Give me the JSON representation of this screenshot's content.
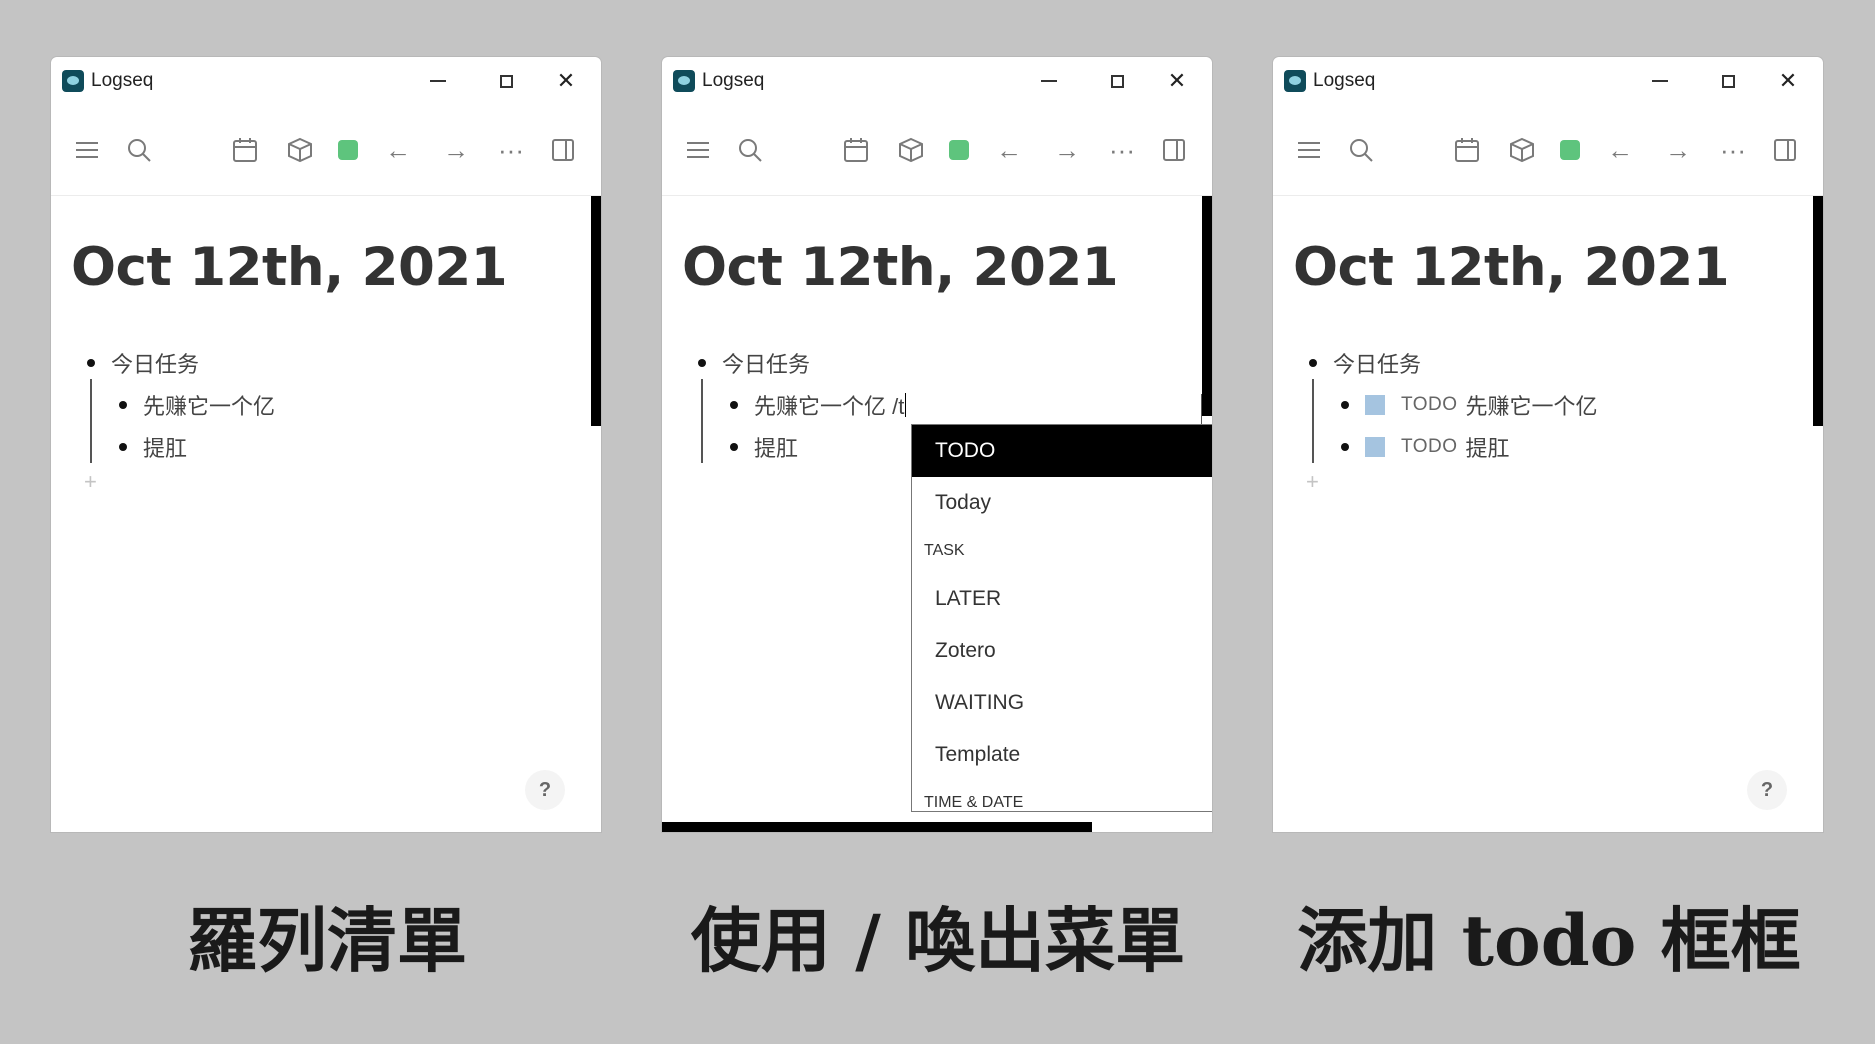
{
  "app_title": "Logseq",
  "page_title": "Oct 12th, 2021",
  "help_label": "?",
  "add_block_label": "+",
  "panels": [
    {
      "caption": "羅列清單",
      "parent": "今日任务",
      "children": [
        "先赚它一个亿",
        "提肛"
      ]
    },
    {
      "caption": "使用 / 喚出菜單",
      "parent": "今日任务",
      "children": [
        "先赚它一个亿 /t",
        "提肛"
      ],
      "menu": {
        "items": [
          "TODO",
          "Today"
        ],
        "group_task": "TASK",
        "task_items": [
          "LATER",
          "Zotero",
          "WAITING",
          "Template"
        ],
        "group_time": "TIME & DATE"
      }
    },
    {
      "caption": "添加 todo 框框",
      "parent": "今日任务",
      "todo_tag": "TODO",
      "children": [
        "先赚它一个亿",
        "提肛"
      ]
    }
  ]
}
